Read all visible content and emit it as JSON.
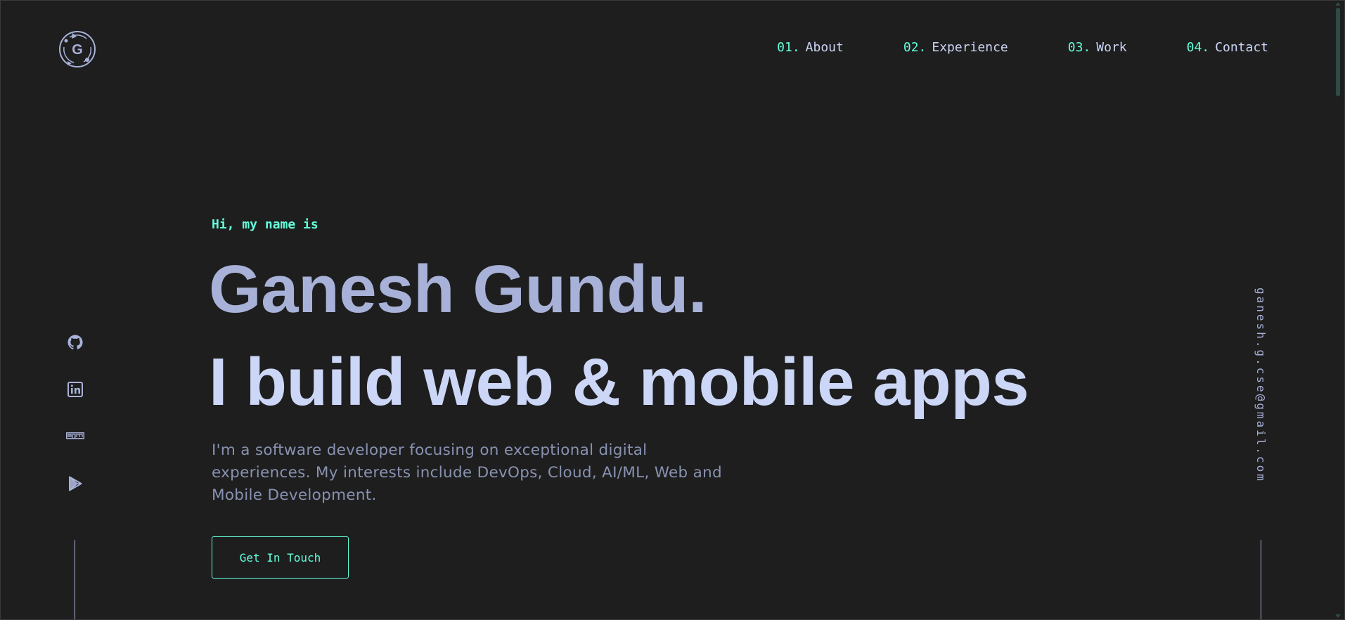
{
  "logo": {
    "letter": "G"
  },
  "nav": [
    {
      "num": "01.",
      "label": "About"
    },
    {
      "num": "02.",
      "label": "Experience"
    },
    {
      "num": "03.",
      "label": "Work"
    },
    {
      "num": "04.",
      "label": "Contact"
    }
  ],
  "hero": {
    "greeting": "Hi, my name is",
    "name": "Ganesh Gundu.",
    "tagline": "I build web & mobile apps",
    "bio": "I'm a software developer focusing on exceptional digital experiences. My interests include DevOps, Cloud, AI/ML, Web and Mobile Development.",
    "cta_label": "Get In Touch"
  },
  "socials": [
    {
      "icon": "github-icon"
    },
    {
      "icon": "linkedin-icon"
    },
    {
      "icon": "npm-icon",
      "text": "npm"
    },
    {
      "icon": "google-play-icon"
    }
  ],
  "email": "ganesh.g.cse@gmail.com",
  "colors": {
    "background": "#1e1e1f",
    "accent": "#64ffda",
    "heading": "#ccd6f6",
    "name": "#a8b2d8",
    "body": "#8892b0"
  }
}
